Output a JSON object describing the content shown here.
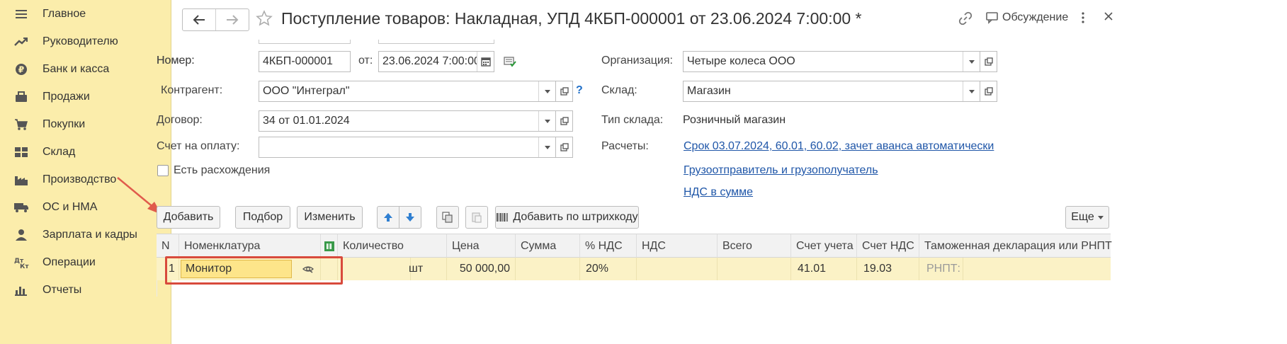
{
  "sidebar": {
    "items": [
      {
        "label": "Главное",
        "icon": "menu-icon"
      },
      {
        "label": "Руководителю",
        "icon": "trend-icon"
      },
      {
        "label": "Банк и касса",
        "icon": "ruble-icon"
      },
      {
        "label": "Продажи",
        "icon": "sales-icon"
      },
      {
        "label": "Покупки",
        "icon": "cart-icon"
      },
      {
        "label": "Склад",
        "icon": "warehouse-icon"
      },
      {
        "label": "Производство",
        "icon": "factory-icon"
      },
      {
        "label": "ОС и НМА",
        "icon": "truck-icon"
      },
      {
        "label": "Зарплата и кадры",
        "icon": "person-icon"
      },
      {
        "label": "Операции",
        "icon": "dt-kt-icon"
      },
      {
        "label": "Отчеты",
        "icon": "bar-chart-icon"
      }
    ]
  },
  "header": {
    "title": "Поступление товаров: Накладная, УПД 4КБП-000001 от 23.06.2024 7:00:00 *",
    "discussion": "Обсуждение"
  },
  "form": {
    "number_label": "Номер:",
    "number_value": "4КБП-000001",
    "date_label": "от:",
    "date_value": "23.06.2024  7:00:00",
    "org_label": "Организация:",
    "org_value": "Четыре колеса ООО",
    "contractor_label": "Контрагент:",
    "contractor_value": "ООО \"Интеграл\"",
    "help": "?",
    "warehouse_label": "Склад:",
    "warehouse_value": "Магазин",
    "contract_label": "Договор:",
    "contract_value": "34 от 01.01.2024",
    "warehouse_type_label": "Тип склада:",
    "warehouse_type_value": "Розничный магазин",
    "invoice_label": "Счет на оплату:",
    "invoice_value": "",
    "settlements_label": "Расчеты:",
    "settlements_link": "Срок 03.07.2024, 60.01, 60.02, зачет аванса автоматически",
    "discrepancy_label": "Есть расхождения",
    "consignor_link": "Грузоотправитель и грузополучатель",
    "vat_link": "НДС в сумме"
  },
  "toolbar": {
    "add": "Добавить",
    "pick": "Подбор",
    "edit": "Изменить",
    "barcode": "Добавить по штрихкоду",
    "more": "Еще"
  },
  "table": {
    "columns": [
      "N",
      "Номенклатура",
      "Количество",
      "Цена",
      "Сумма",
      "% НДС",
      "НДС",
      "Всего",
      "Счет учета",
      "Счет НДС",
      "Таможенная декларация или РНПТ"
    ],
    "rows": [
      {
        "n": "1",
        "item": "Монитор",
        "qty": "",
        "unit": "шт",
        "price": "50 000,00",
        "sum": "",
        "vat_rate": "20%",
        "vat": "",
        "total": "",
        "account": "41.01",
        "vat_account": "19.03",
        "customs": "РНПТ:"
      }
    ]
  },
  "colors": {
    "sidebar_bg": "#fbedab",
    "link": "#1f56a8",
    "row_highlight": "#fbf2c6",
    "cell_active": "#fde58a",
    "annotation": "#d84a3c"
  }
}
